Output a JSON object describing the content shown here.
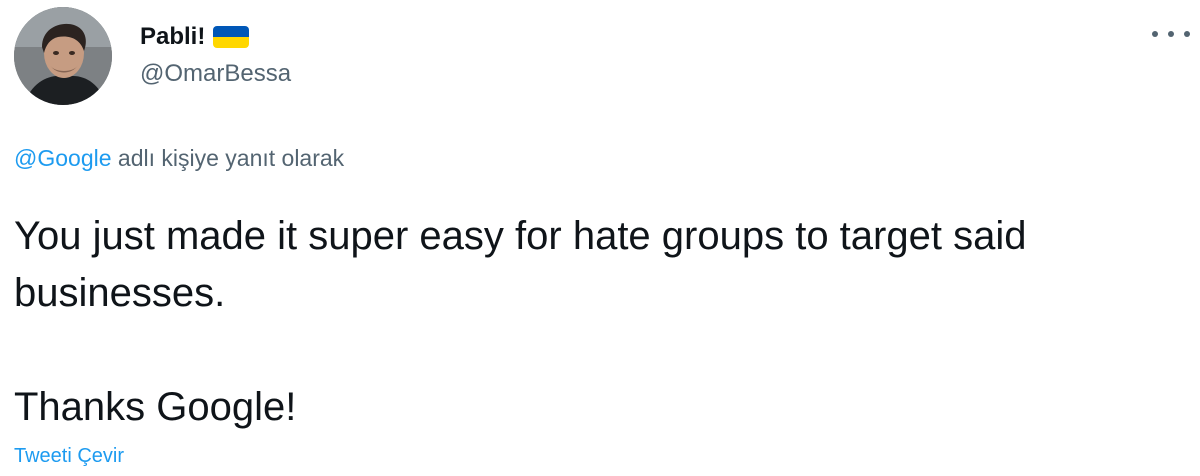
{
  "user": {
    "display_name": "Pabli!",
    "handle": "@OmarBessa",
    "flag_icon": "ukraine-flag-icon",
    "flag_colors": [
      "#0057b7",
      "#ffd700"
    ]
  },
  "menu": {
    "icon": "more-horizontal-icon"
  },
  "reply_context": {
    "mention": "@Google",
    "text": " adlı kişiye yanıt olarak"
  },
  "tweet": {
    "text_line1": "You just made it super easy for hate groups to target said businesses.",
    "text_line2": "Thanks Google!"
  },
  "actions": {
    "translate_label": "Tweeti Çevir"
  },
  "colors": {
    "text": "#0f1419",
    "secondary": "#536471",
    "link": "#1d9bf0"
  }
}
